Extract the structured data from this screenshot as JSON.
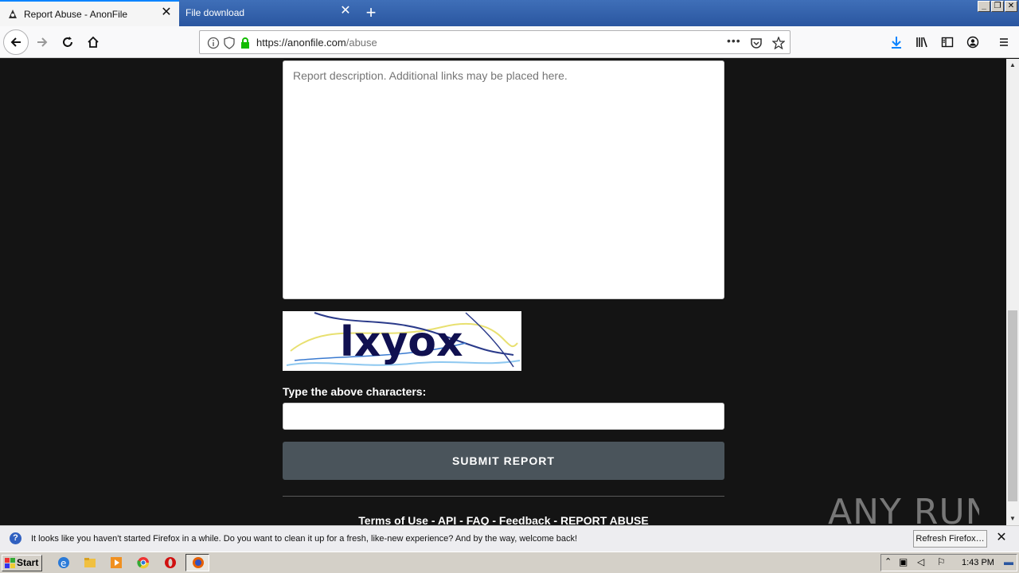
{
  "browser": {
    "tabs": [
      {
        "title": "Report Abuse - AnonFile",
        "active": true
      },
      {
        "title": "File download",
        "active": false
      }
    ],
    "url_host": "https://anonfile.com",
    "url_path": "/abuse"
  },
  "form": {
    "description_placeholder": "Report description. Additional links may be placed here.",
    "captcha_text": "lxyox",
    "captcha_label": "Type the above characters:",
    "captcha_input_value": "",
    "submit_label": "SUBMIT REPORT"
  },
  "footer": {
    "links": [
      "Terms of Use",
      "API",
      "FAQ",
      "Feedback",
      "REPORT ABUSE"
    ],
    "separator": " - "
  },
  "watermark": {
    "text": "ANY RUN"
  },
  "notification": {
    "message": "It looks like you haven't started Firefox in a while. Do you want to clean it up for a fresh, like-new experience? And by the way, welcome back!",
    "button_label": "Refresh Firefox…"
  },
  "taskbar": {
    "start_label": "Start",
    "clock": "1:43 PM"
  },
  "colors": {
    "page_bg": "#141414",
    "submit_bg": "#4a545b",
    "tab_accent": "#0a84ff",
    "lock_green": "#12bc00"
  }
}
